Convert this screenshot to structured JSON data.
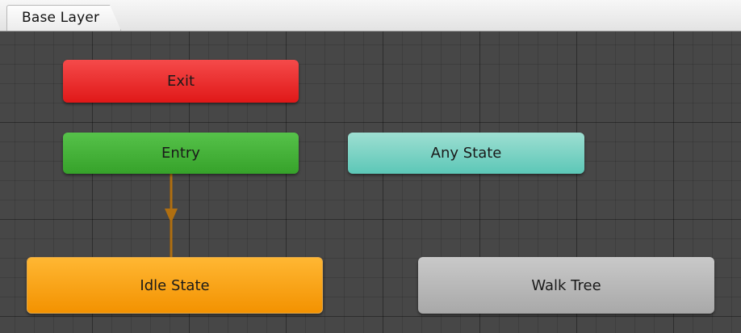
{
  "breadcrumb": {
    "label": "Base Layer"
  },
  "states": {
    "exit": "Exit",
    "entry": "Entry",
    "any_state": "Any State",
    "idle": "Idle State",
    "walk_tree": "Walk Tree"
  },
  "colors": {
    "exit": "#e52a2a",
    "entry": "#45b23a",
    "any_state": "#7dd3c5",
    "default_state": "#f7a11a",
    "blend_tree": "#b8b8b8",
    "transition": "#b06f10",
    "grid_background": "#474747"
  }
}
